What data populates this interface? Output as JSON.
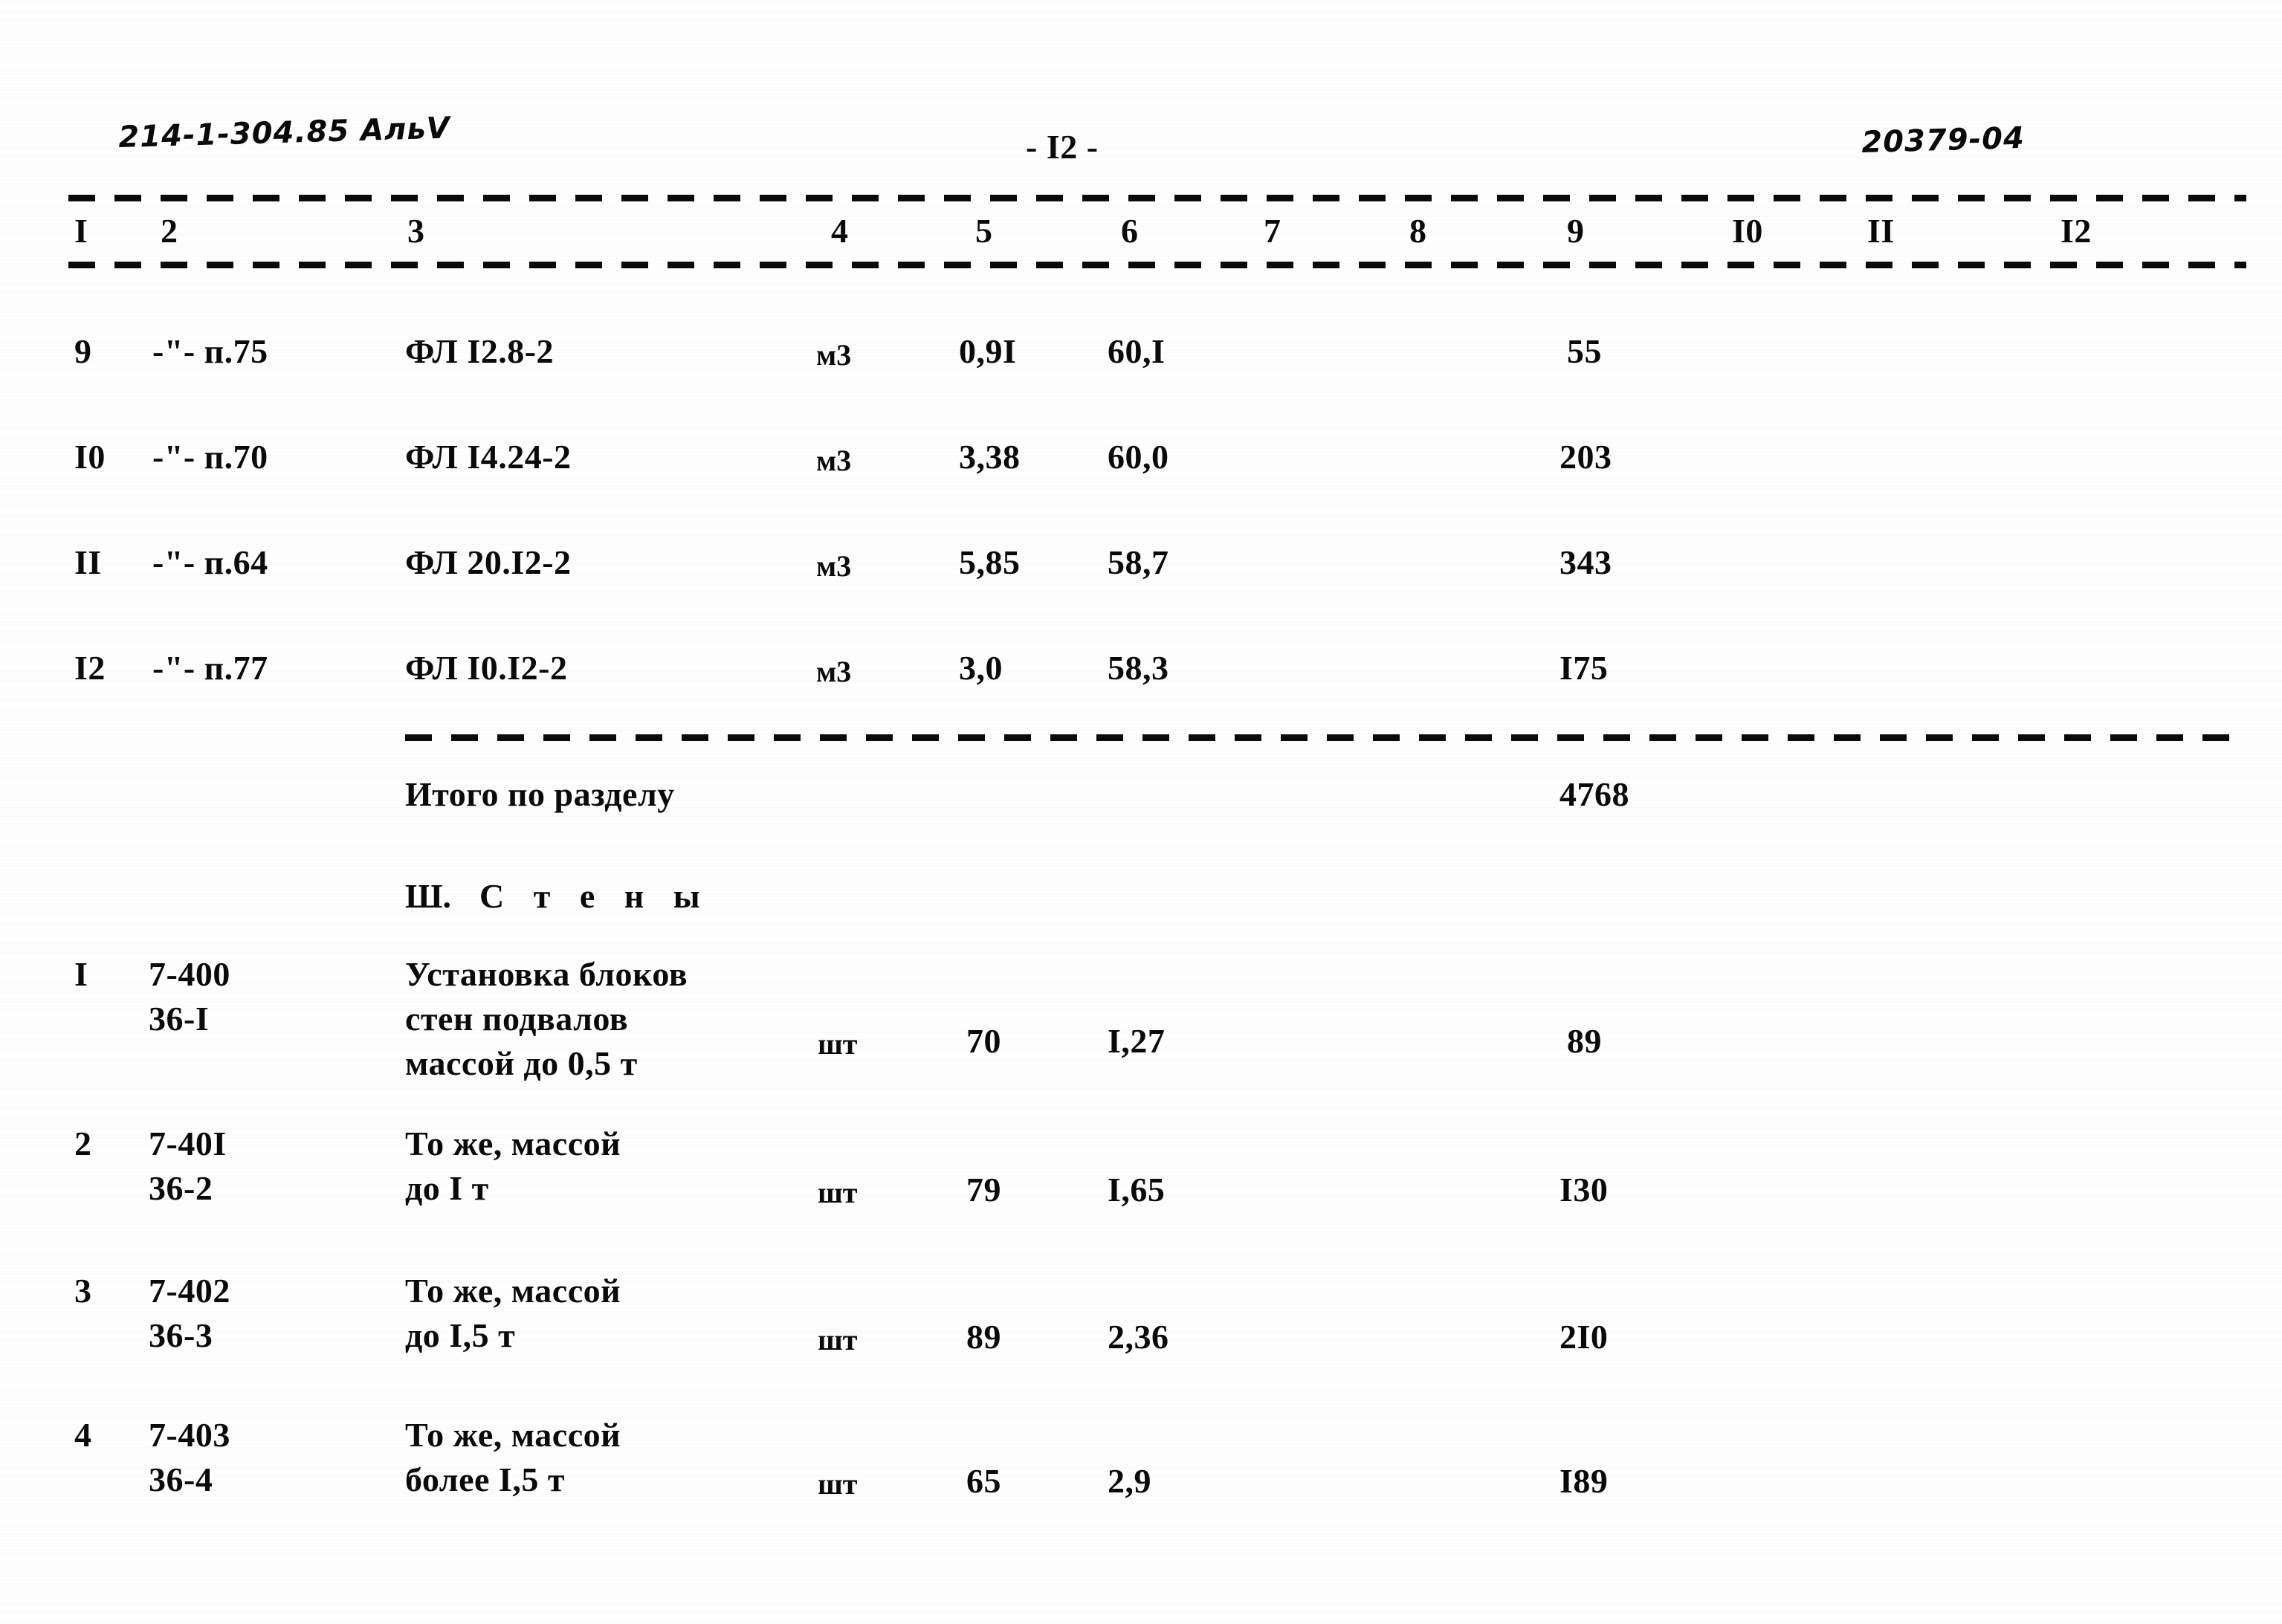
{
  "document": {
    "series_code_handwritten": "214-1-304.85 АльV",
    "page_label": "- I2 -",
    "archive_code_handwritten": "20379-04"
  },
  "table": {
    "column_headers": [
      "I",
      "2",
      "3",
      "4",
      "5",
      "6",
      "7",
      "8",
      "9",
      "I0",
      "II",
      "I2"
    ],
    "rows_part1": [
      {
        "c1": "9",
        "c2": "-\"- п.75",
        "c3": "ФЛ I2.8-2",
        "c4": "м3",
        "c5": "0,9I",
        "c6": "60,I",
        "c7": "",
        "c8": "",
        "c9": "55",
        "c10": "",
        "c11": "",
        "c12": ""
      },
      {
        "c1": "I0",
        "c2": "-\"- п.70",
        "c3": "ФЛ I4.24-2",
        "c4": "м3",
        "c5": "3,38",
        "c6": "60,0",
        "c7": "",
        "c8": "",
        "c9": "203",
        "c10": "",
        "c11": "",
        "c12": ""
      },
      {
        "c1": "II",
        "c2": "-\"- п.64",
        "c3": "ФЛ 20.I2-2",
        "c4": "м3",
        "c5": "5,85",
        "c6": "58,7",
        "c7": "",
        "c8": "",
        "c9": "343",
        "c10": "",
        "c11": "",
        "c12": ""
      },
      {
        "c1": "I2",
        "c2": "-\"- п.77",
        "c3": "ФЛ I0.I2-2",
        "c4": "м3",
        "c5": "3,0",
        "c6": "58,3",
        "c7": "",
        "c8": "",
        "c9": "I75",
        "c10": "",
        "c11": "",
        "c12": ""
      }
    ],
    "subtotal": {
      "label": "Итого по разделу",
      "value": "4768"
    },
    "section": {
      "number": "Ш.",
      "title": "С т е н ы"
    },
    "rows_part2": [
      {
        "c1": "I",
        "code_top": "7-400",
        "code_bottom": "36-I",
        "desc_line1": "Установка блоков",
        "desc_line2": "стен подвалов",
        "desc_line3": "массой до 0,5 т",
        "c4": "шт",
        "c5": "70",
        "c6": "I,27",
        "c7": "",
        "c8": "",
        "c9": "89",
        "c10": "",
        "c11": "",
        "c12": ""
      },
      {
        "c1": "2",
        "code_top": "7-40I",
        "code_bottom": "36-2",
        "desc_line1": "То же, массой",
        "desc_line2": "до I т",
        "desc_line3": "",
        "c4": "шт",
        "c5": "79",
        "c6": "I,65",
        "c7": "",
        "c8": "",
        "c9": "I30",
        "c10": "",
        "c11": "",
        "c12": ""
      },
      {
        "c1": "3",
        "code_top": "7-402",
        "code_bottom": "36-3",
        "desc_line1": "То же, массой",
        "desc_line2": "до I,5 т",
        "desc_line3": "",
        "c4": "шт",
        "c5": "89",
        "c6": "2,36",
        "c7": "",
        "c8": "",
        "c9": "2I0",
        "c10": "",
        "c11": "",
        "c12": ""
      },
      {
        "c1": "4",
        "code_top": "7-403",
        "code_bottom": "36-4",
        "desc_line1": "То же, массой",
        "desc_line2": "более I,5 т",
        "desc_line3": "",
        "c4": "шт",
        "c5": "65",
        "c6": "2,9",
        "c7": "",
        "c8": "",
        "c9": "I89",
        "c10": "",
        "c11": "",
        "c12": ""
      }
    ]
  }
}
